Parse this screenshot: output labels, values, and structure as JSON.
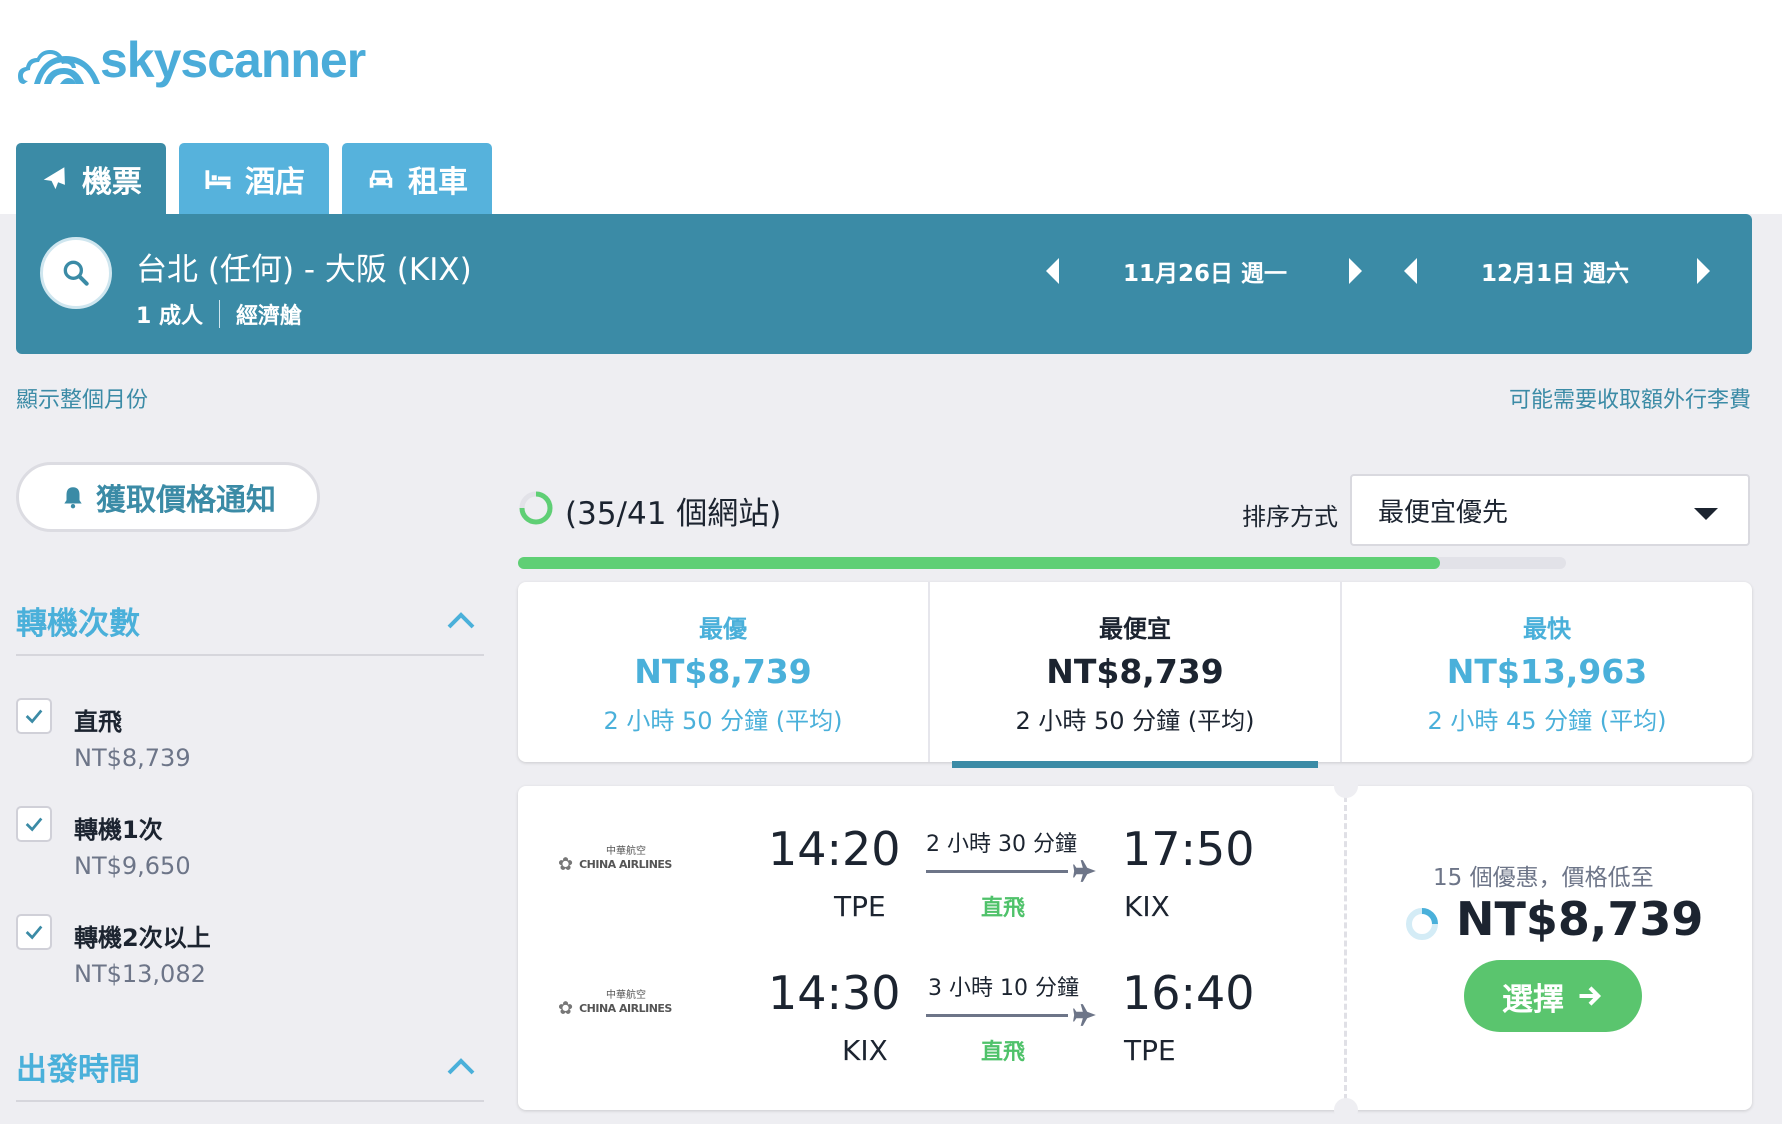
{
  "brand": {
    "name": "skyscanner"
  },
  "tabs": [
    {
      "label": "機票",
      "icon": "plane-icon"
    },
    {
      "label": "酒店",
      "icon": "bed-icon"
    },
    {
      "label": "租車",
      "icon": "car-icon"
    }
  ],
  "search": {
    "route": "台北 (任何) - 大阪 (KIX)",
    "passengers": "1 成人",
    "cabin": "經濟艙",
    "depart_date": "11月26日 週一",
    "return_date": "12月1日 週六"
  },
  "links": {
    "show_month": "顯示整個月份",
    "baggage_fee": "可能需要收取額外行李費"
  },
  "price_alert": {
    "label": "獲取價格通知"
  },
  "filters": {
    "stops_title": "轉機次數",
    "stops": [
      {
        "label": "直飛",
        "price": "NT$8,739",
        "checked": true
      },
      {
        "label": "轉機1次",
        "price": "NT$9,650",
        "checked": true
      },
      {
        "label": "轉機2次以上",
        "price": "NT$13,082",
        "checked": true
      }
    ],
    "depart_time_title": "出發時間"
  },
  "results": {
    "site_count": "(35/41 個網站)",
    "load_progress": 0.88,
    "sort_label": "排序方式",
    "sort_value": "最便宜優先"
  },
  "sort_tabs": [
    {
      "title": "最優",
      "price": "NT$8,739",
      "duration": "2 小時 50 分鐘 (平均)"
    },
    {
      "title": "最便宜",
      "price": "NT$8,739",
      "duration": "2 小時 50 分鐘 (平均)",
      "active": true
    },
    {
      "title": "最快",
      "price": "NT$13,963",
      "duration": "2 小時 45 分鐘 (平均)"
    }
  ],
  "card": {
    "airline": {
      "name": "CHINA AIRLINES",
      "native_name": "中華航空"
    },
    "outbound": {
      "depart_time": "14:20",
      "depart_code": "TPE",
      "duration": "2 小時 30 分鐘",
      "stops": "直飛",
      "arrive_time": "17:50",
      "arrive_code": "KIX"
    },
    "inbound": {
      "depart_time": "14:30",
      "depart_code": "KIX",
      "duration": "3 小時 10 分鐘",
      "stops": "直飛",
      "arrive_time": "16:40",
      "arrive_code": "TPE"
    },
    "deals": "15 個優惠，價格低至",
    "price": "NT$8,739",
    "select_label": "選擇"
  },
  "colors": {
    "primary": "#3b8ba6",
    "tab": "#56b2dc",
    "accent": "#4ab0da",
    "success": "#5ac56e",
    "background": "#eeeef2"
  }
}
